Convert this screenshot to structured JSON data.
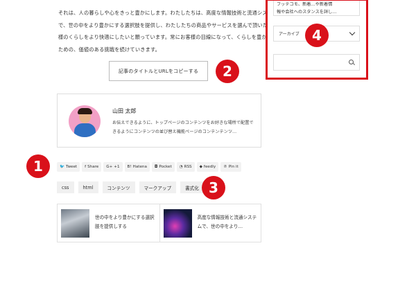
{
  "article": {
    "paragraph_lines": [
      "それは、人の暮らしや心をきっと豊かにします。わたしたちは、高度な情報技術と流通システム",
      "で、世の中をより豊かにする選択肢を提供し、わたしたちの商品やサービスを選んで頂いた、お客",
      "様のくらしをより快適にしたいと願っています。常にお客様の目線になって、くらしを豊かにする",
      "ための、価値のある挑戦を続けていきます。"
    ],
    "copy_button_label": "記事のタイトルとURLをコピーする"
  },
  "badges": [
    "1",
    "2",
    "3",
    "4"
  ],
  "author": {
    "name": "山田 太郎",
    "bio": "お伝えできるように、トップページのコンテンツをお好きな場所で配置できるようにコンテンツの並び替え機能ページのコンテンテンツ…"
  },
  "share_buttons": [
    {
      "icon": "twitter-icon",
      "glyph": "🐦",
      "label": "Tweet"
    },
    {
      "icon": "facebook-icon",
      "glyph": "f",
      "label": "Share"
    },
    {
      "icon": "googleplus-icon",
      "glyph": "G+",
      "label": "+1"
    },
    {
      "icon": "hatena-icon",
      "glyph": "B!",
      "label": "Hatena"
    },
    {
      "icon": "pocket-icon",
      "glyph": "◘",
      "label": "Pocket"
    },
    {
      "icon": "rss-icon",
      "glyph": "◔",
      "label": "RSS"
    },
    {
      "icon": "feedly-icon",
      "glyph": "◆",
      "label": "feedly"
    },
    {
      "icon": "pinterest-icon",
      "glyph": "℗",
      "label": "Pin it"
    }
  ],
  "tags": [
    "css",
    "html",
    "コンテンツ",
    "マークアップ",
    "書式化"
  ],
  "related": [
    {
      "title": "世の中をより豊かにする選択肢を提供しする"
    },
    {
      "title": "高度な情報技術と流通システムで、世の中をより…"
    }
  ],
  "sidebar": {
    "text_lines": [
      "フッテコモ、新着…や新着情",
      "報や会社へのスタンスを詳し…"
    ],
    "archive_label": "アーカイブ"
  },
  "colors": {
    "accent": "#d9111a"
  }
}
